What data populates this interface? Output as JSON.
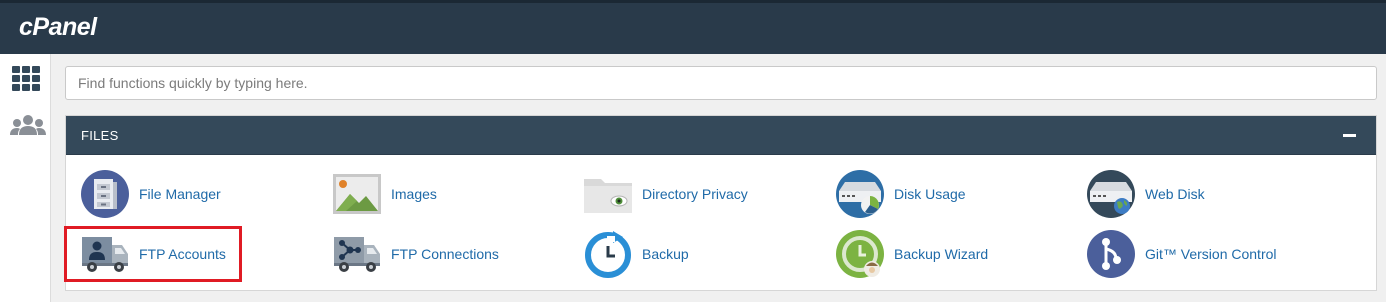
{
  "app": {
    "logo_text": "cPanel"
  },
  "sidebar": {
    "items": [
      {
        "icon": "grid-icon",
        "label": ""
      },
      {
        "icon": "users-icon",
        "label": ""
      }
    ]
  },
  "search": {
    "placeholder": "Find functions quickly by typing here.",
    "value": ""
  },
  "files_section": {
    "title": "FILES",
    "collapse_icon": "minus-icon",
    "items": [
      {
        "label": "File Manager",
        "icon": "file-manager-icon"
      },
      {
        "label": "Images",
        "icon": "images-icon"
      },
      {
        "label": "Directory Privacy",
        "icon": "directory-privacy-icon"
      },
      {
        "label": "Disk Usage",
        "icon": "disk-usage-icon"
      },
      {
        "label": "Web Disk",
        "icon": "web-disk-icon"
      },
      {
        "label": "FTP Accounts",
        "icon": "ftp-accounts-icon"
      },
      {
        "label": "FTP Connections",
        "icon": "ftp-connections-icon"
      },
      {
        "label": "Backup",
        "icon": "backup-icon"
      },
      {
        "label": "Backup Wizard",
        "icon": "backup-wizard-icon"
      },
      {
        "label": "Git™ Version Control",
        "icon": "git-icon"
      }
    ]
  },
  "annotation": {
    "highlighted_item": "FTP Accounts",
    "color": "#e01b24"
  },
  "colors": {
    "topbar": "#293a4a",
    "panel_header": "#34495a",
    "link": "#1f6aa8",
    "highlight": "#e01b24"
  }
}
